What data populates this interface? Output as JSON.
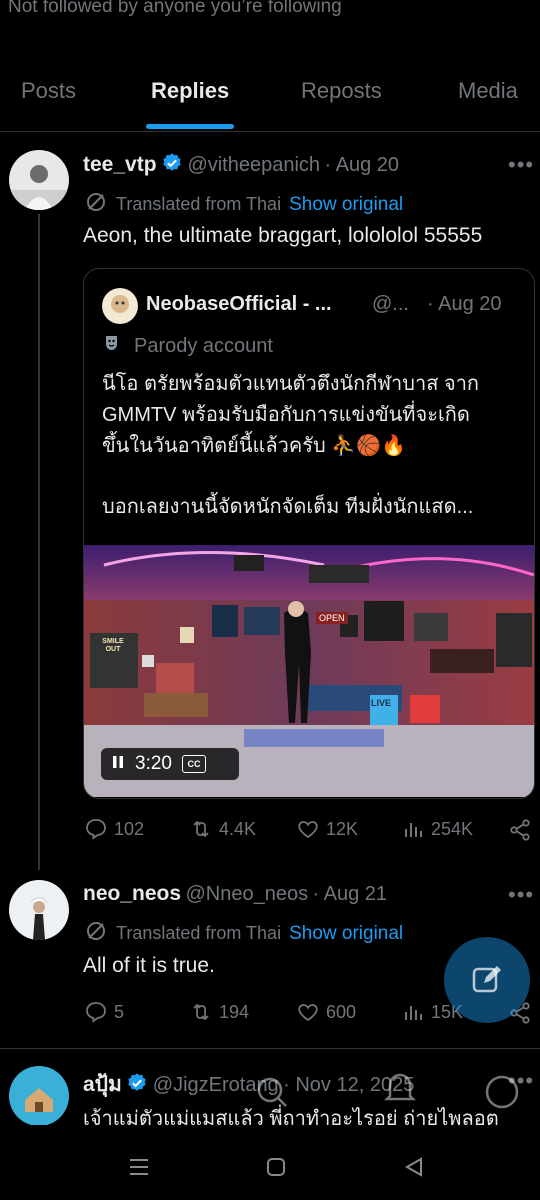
{
  "header": {
    "not_followed": "Not followed by anyone you’re following"
  },
  "tabs": [
    {
      "label": "Posts"
    },
    {
      "label": "Replies"
    },
    {
      "label": "Reposts"
    },
    {
      "label": "Media"
    }
  ],
  "post1": {
    "name": "tee_vtp",
    "handle": "@vitheepanich",
    "date": "· Aug 20",
    "translated": "Translated from Thai",
    "show_original": "Show original",
    "text": "Aeon, the ultimate braggart, lolololol 55555",
    "quote": {
      "name": "NeobaseOfficial - ...",
      "handle": "@...",
      "date": "· Aug 20",
      "parody": "Parody account",
      "line1": "นีโอ ตรัยพร้อมตัวแทนตัวตึงนักกีฬาบาส จาก",
      "line2": "GMMTV  พร้อมรับมือกับการแข่งขันที่จะเกิด",
      "line3": "ขึ้นในวันอาทิตย์นี้แล้วครับ ⛹️🏀🔥",
      "line4": "บอกเลยงานนี้จัดหนักจัดเต็ม ทีมฝั่งนักแสด...",
      "video_time": "3:20",
      "cc": "CC",
      "live_sign": "LIVE",
      "open_sign": "OPEN",
      "poster_title": "SMILE OUT"
    },
    "replies": "102",
    "reposts": "4.4K",
    "likes": "12K",
    "views": "254K"
  },
  "post2": {
    "name": "neo_neos",
    "handle": "@Nneo_neos",
    "date": "· Aug 21",
    "translated": "Translated from Thai",
    "show_original": "Show original",
    "text": "All of it is true.",
    "replies": "5",
    "reposts": "194",
    "likes": "600",
    "views": "15K"
  },
  "post3": {
    "name": "aปุ้ม",
    "handle": "@JigzErotang",
    "date": "· Nov 12, 2025",
    "text": "เจ้าแม่ตัวแม่แมสแล้ว พี่ถาทำอะไรอยู่ ถ่ายไพลอต"
  },
  "colors": {
    "accent": "#1d9bf0",
    "muted": "#71767b",
    "background": "#000000"
  }
}
